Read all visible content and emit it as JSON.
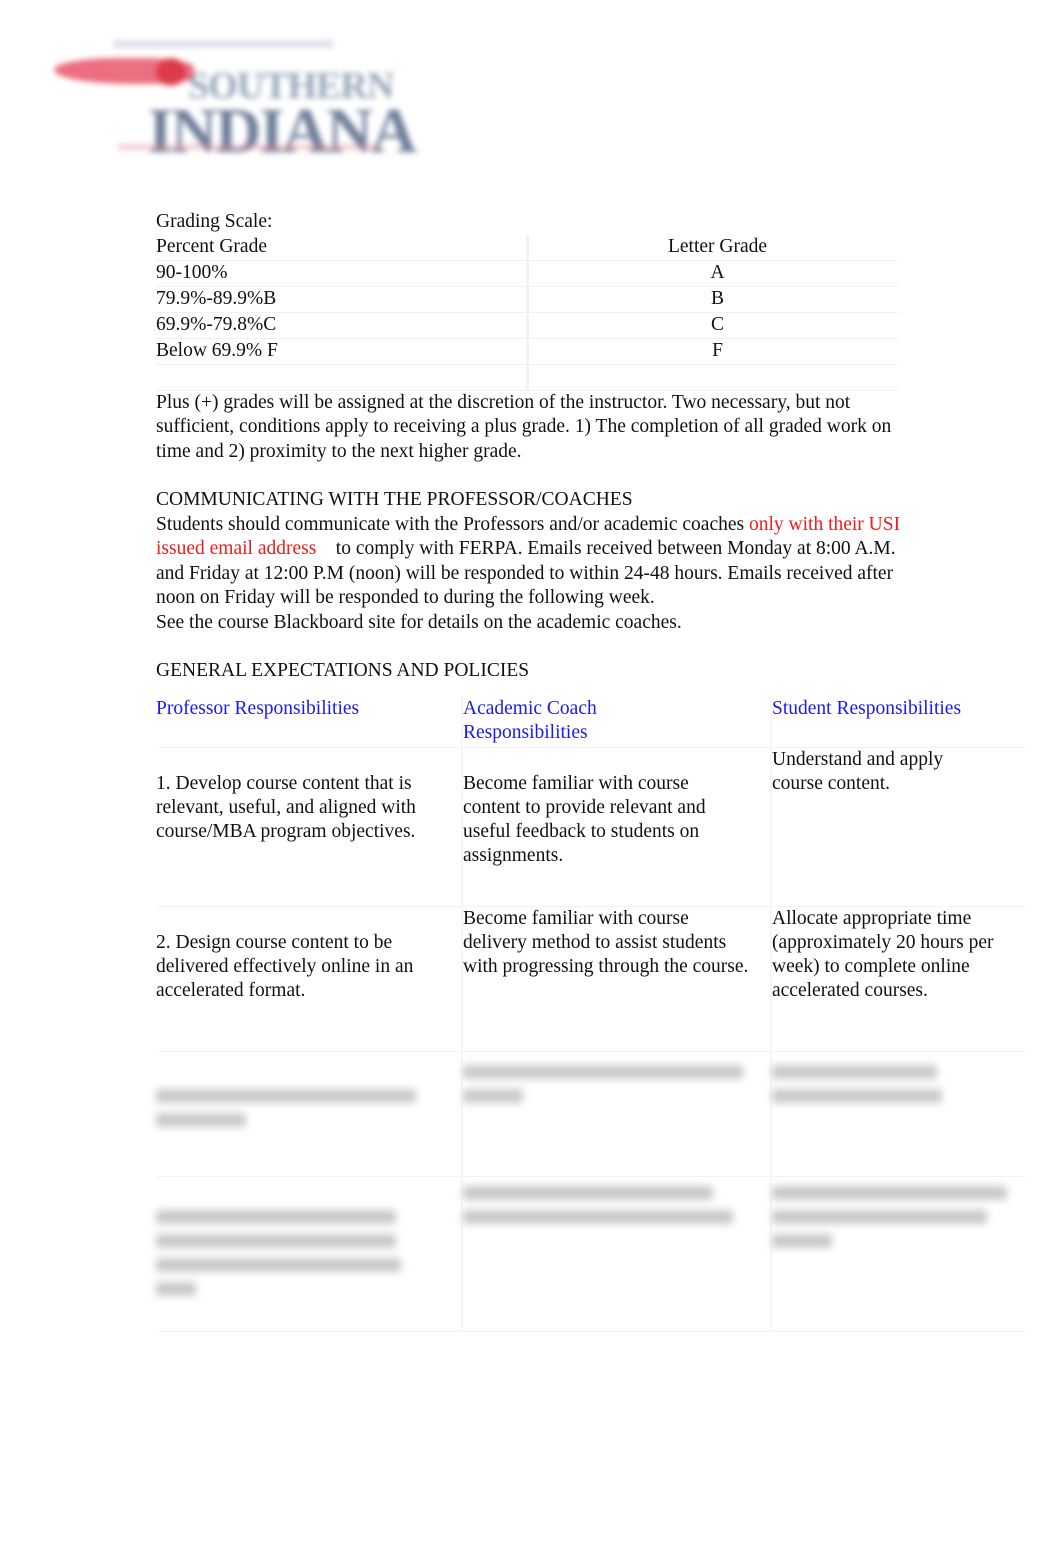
{
  "logo": {
    "name": "university-logo",
    "text_line1": "SOUTHERN",
    "text_line2": "INDIANA"
  },
  "grading": {
    "title": "Grading Scale:",
    "headers": [
      "Percent Grade",
      "Letter Grade"
    ],
    "rows": [
      {
        "percent": "90-100%",
        "letter": "A"
      },
      {
        "percent": "79.9%-89.9%B",
        "letter": "B"
      },
      {
        "percent": "69.9%-79.8%C",
        "letter": "C"
      },
      {
        "percent": "Below 69.9% F",
        "letter": "F"
      }
    ],
    "plus_note": "Plus (+) grades will be assigned at the discretion of the instructor. Two necessary, but not sufficient, conditions apply to receiving a plus grade. 1) The completion of all graded work on time and 2) proximity to the next higher grade."
  },
  "communicating": {
    "heading": "COMMUNICATING WITH THE PROFESSOR/COACHES",
    "text_before": "Students should communicate with the Professors and/or academic coaches ",
    "highlight": "only with their USI issued email address",
    "text_after": "    to comply with FERPA. Emails received between Monday at 8:00 A.M. and Friday at 12:00 P.M (noon) will be responded to within 24-48 hours. Emails received after noon on Friday will be responded to during the following week.",
    "blackboard_note": "See the course Blackboard site for details on the academic coaches."
  },
  "expectations": {
    "heading": "GENERAL EXPECTATIONS AND POLICIES",
    "columns": [
      "Professor Responsibilities",
      "Academic Coach Responsibilities",
      "Student Responsibilities"
    ],
    "rows": [
      {
        "professor": "1. Develop course content that is relevant, useful, and aligned with course/MBA program objectives.",
        "coach": "Become familiar with course content to provide relevant and useful feedback to students on assignments.",
        "student": "Understand and apply course content."
      },
      {
        "professor": "2. Design course content to be delivered effectively online in an accelerated format.",
        "coach": "Become familiar with course delivery method to assist students with progressing through the course.",
        "student": "Allocate appropriate time (approximately 20 hours per week) to complete online accelerated courses."
      }
    ],
    "blurred_rows_count": 2
  },
  "colors": {
    "highlight_red": "#ee1c1c",
    "header_blue": "#1a1aee"
  }
}
